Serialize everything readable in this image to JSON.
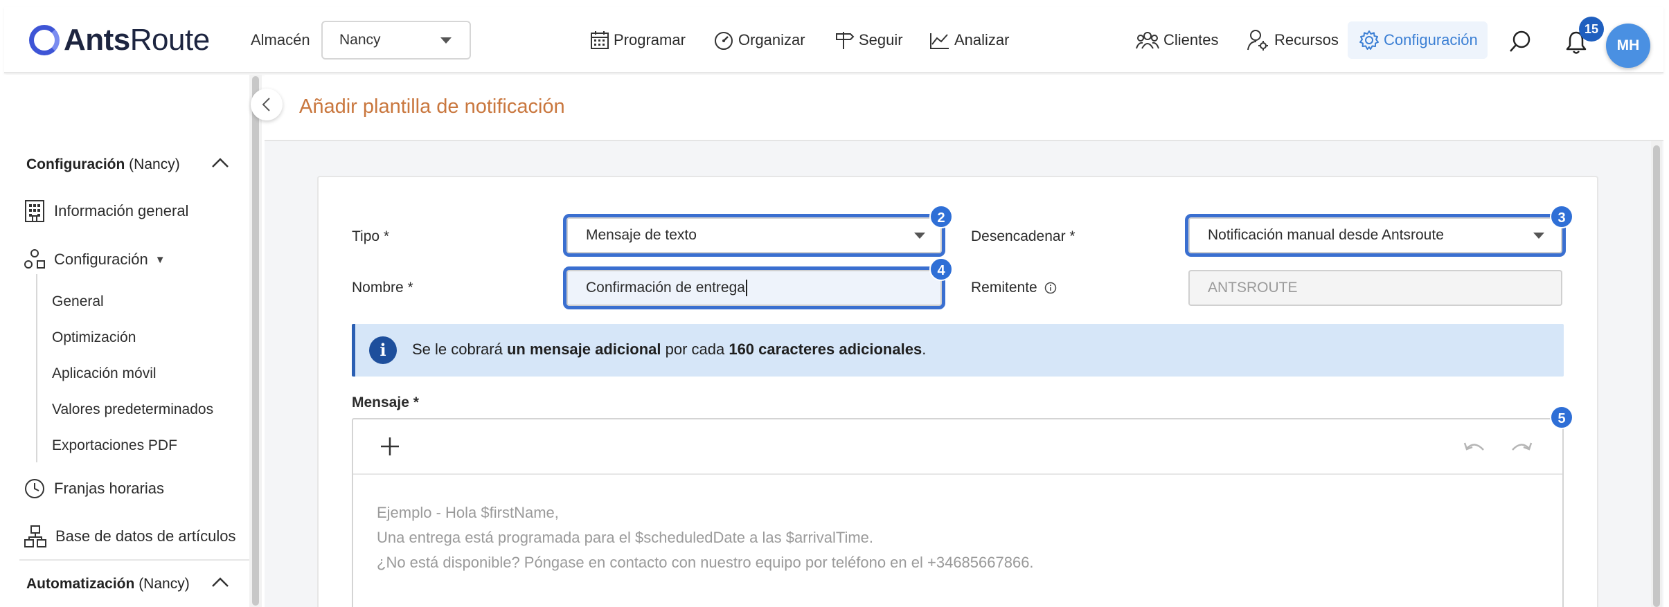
{
  "header": {
    "logo_bold": "Ants",
    "logo_light": "Route",
    "almacen_label": "Almacén",
    "almacen_value": "Nancy",
    "nav": {
      "programar": "Programar",
      "organizar": "Organizar",
      "seguir": "Seguir",
      "analizar": "Analizar",
      "clientes": "Clientes",
      "recursos": "Recursos",
      "configuracion": "Configuración"
    },
    "notification_count": "15",
    "avatar_initials": "MH",
    "accent_color": "#3b7fd4"
  },
  "sidebar": {
    "config_section": {
      "title": "Configuración",
      "scope": "(Nancy)"
    },
    "items": {
      "info_general": "Información general",
      "configuracion": "Configuración",
      "configuracion_caret": "▼",
      "franjas": "Franjas horarias",
      "base_datos": "Base de datos de artículos"
    },
    "sub_items": {
      "general": "General",
      "optimizacion": "Optimización",
      "app_movil": "Aplicación móvil",
      "valores": "Valores predeterminados",
      "exportaciones": "Exportaciones PDF"
    },
    "auto_section": {
      "title": "Automatización",
      "scope": "(Nancy)"
    }
  },
  "page": {
    "title": "Añadir plantilla de notificación",
    "title_color": "#c9773e"
  },
  "form": {
    "tipo_label": "Tipo *",
    "tipo_value": "Mensaje de texto",
    "desencadenar_label": "Desencadenar *",
    "desencadenar_value": "Notificación manual desde Antsroute",
    "nombre_label": "Nombre *",
    "nombre_value": "Confirmación de entrega",
    "remitente_label": "Remitente",
    "remitente_value": "ANTSROUTE",
    "mensaje_label": "Mensaje *",
    "badges": {
      "b2": "2",
      "b3": "3",
      "b4": "4",
      "b5": "5"
    }
  },
  "banner": {
    "icon": "i",
    "t1": "Se le cobrará ",
    "b1": "un mensaje adicional",
    "t2": " por cada ",
    "b2": "160 caracteres adicionales",
    "t3": "."
  },
  "editor": {
    "placeholder_lines": [
      "Ejemplo - Hola $firstName,",
      "Una entrega está programada para el $scheduledDate a las $arrivalTime.",
      "¿No está disponible? Póngase en contacto con nuestro equipo por teléfono en el +34685667866."
    ]
  }
}
